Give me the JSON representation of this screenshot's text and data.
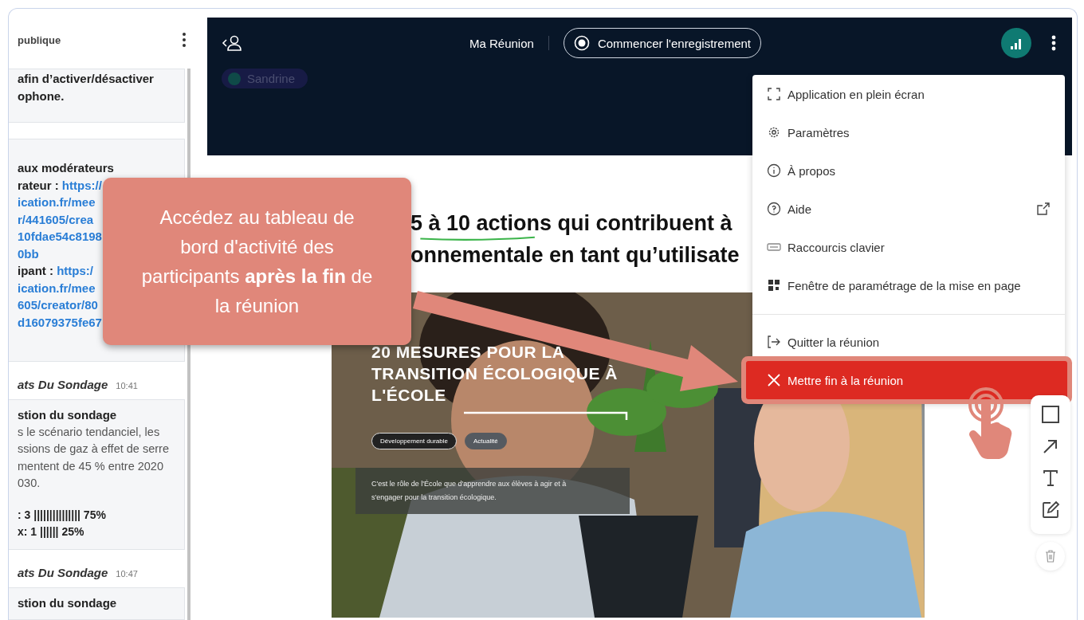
{
  "sidebar": {
    "title": "publique",
    "messages": [
      {
        "kind": "note",
        "text": "afin d’activer/désactiver\nophone."
      },
      {
        "kind": "links",
        "lines": [
          {
            "text": "aux modérateurs"
          },
          {
            "text": "rateur :",
            "link": "https://"
          },
          {
            "link": "ication.fr/mee"
          },
          {
            "link": "r/441605/crea"
          },
          {
            "link": "10fdae54c8198"
          },
          {
            "link": "0bb"
          },
          {
            "text": "ipant :",
            "link": "https:/"
          },
          {
            "link": "ication.fr/mee"
          },
          {
            "link": "605/creator/80"
          },
          {
            "link": "d16079375fe67"
          }
        ]
      },
      {
        "kind": "poll",
        "author": "ats Du Sondage",
        "time": "10:41",
        "title": "stion du sondage",
        "body": "s le scénario tendanciel, les\nssions de gaz à effet de serre\nmentent de 45 % entre 2020\n030.",
        "results": [
          ": 3 ||||||||||||||| 75%",
          "x: 1 |||||| 25%"
        ]
      },
      {
        "kind": "poll",
        "author": "ats Du Sondage",
        "time": "10:47",
        "title": "stion du sondage"
      }
    ]
  },
  "topbar": {
    "title": "Ma Réunion",
    "record_button": "Commencer l'enregistrement",
    "participant": "Sandrine"
  },
  "menu": {
    "groups": [
      {
        "items": [
          {
            "label": "Application en plein écran",
            "external": false,
            "selected": false
          },
          {
            "label": "Paramètres",
            "external": false,
            "selected": false
          },
          {
            "label": "À propos",
            "external": false,
            "selected": false
          },
          {
            "label": "Aide",
            "external": true,
            "selected": false
          },
          {
            "label": "Raccourcis clavier",
            "external": false,
            "selected": false
          },
          {
            "label": "Fenêtre de paramétrage de la mise en page",
            "external": false,
            "selected": false
          }
        ]
      },
      {
        "items": [
          {
            "label": "Quitter la réunion",
            "external": false,
            "selected": false
          },
          {
            "label": "Mettre fin à la réunion",
            "external": false,
            "selected": true
          }
        ]
      }
    ]
  },
  "slide": {
    "heading": [
      "5 à 10 actions qui contribuent à",
      "onnementale en tant qu’utilisate"
    ],
    "picture": {
      "kind": "picture",
      "title": "20 MESURES POUR LA\nTRANSITION ÉCOLOGIQUE À\nL'ÉCOLE",
      "tags": [
        {
          "label": "Développement durable",
          "kind": "outline"
        },
        {
          "label": "Actualité",
          "kind": "filled"
        }
      ],
      "caption": "C'est le rôle de l'École que d'apprendre aux élèves à agir et à\ns'engager pour la transition écologique."
    }
  },
  "callout": {
    "text": "Accédez au tableau de bord d'activité des participants **après la fin** de la réunion"
  }
}
